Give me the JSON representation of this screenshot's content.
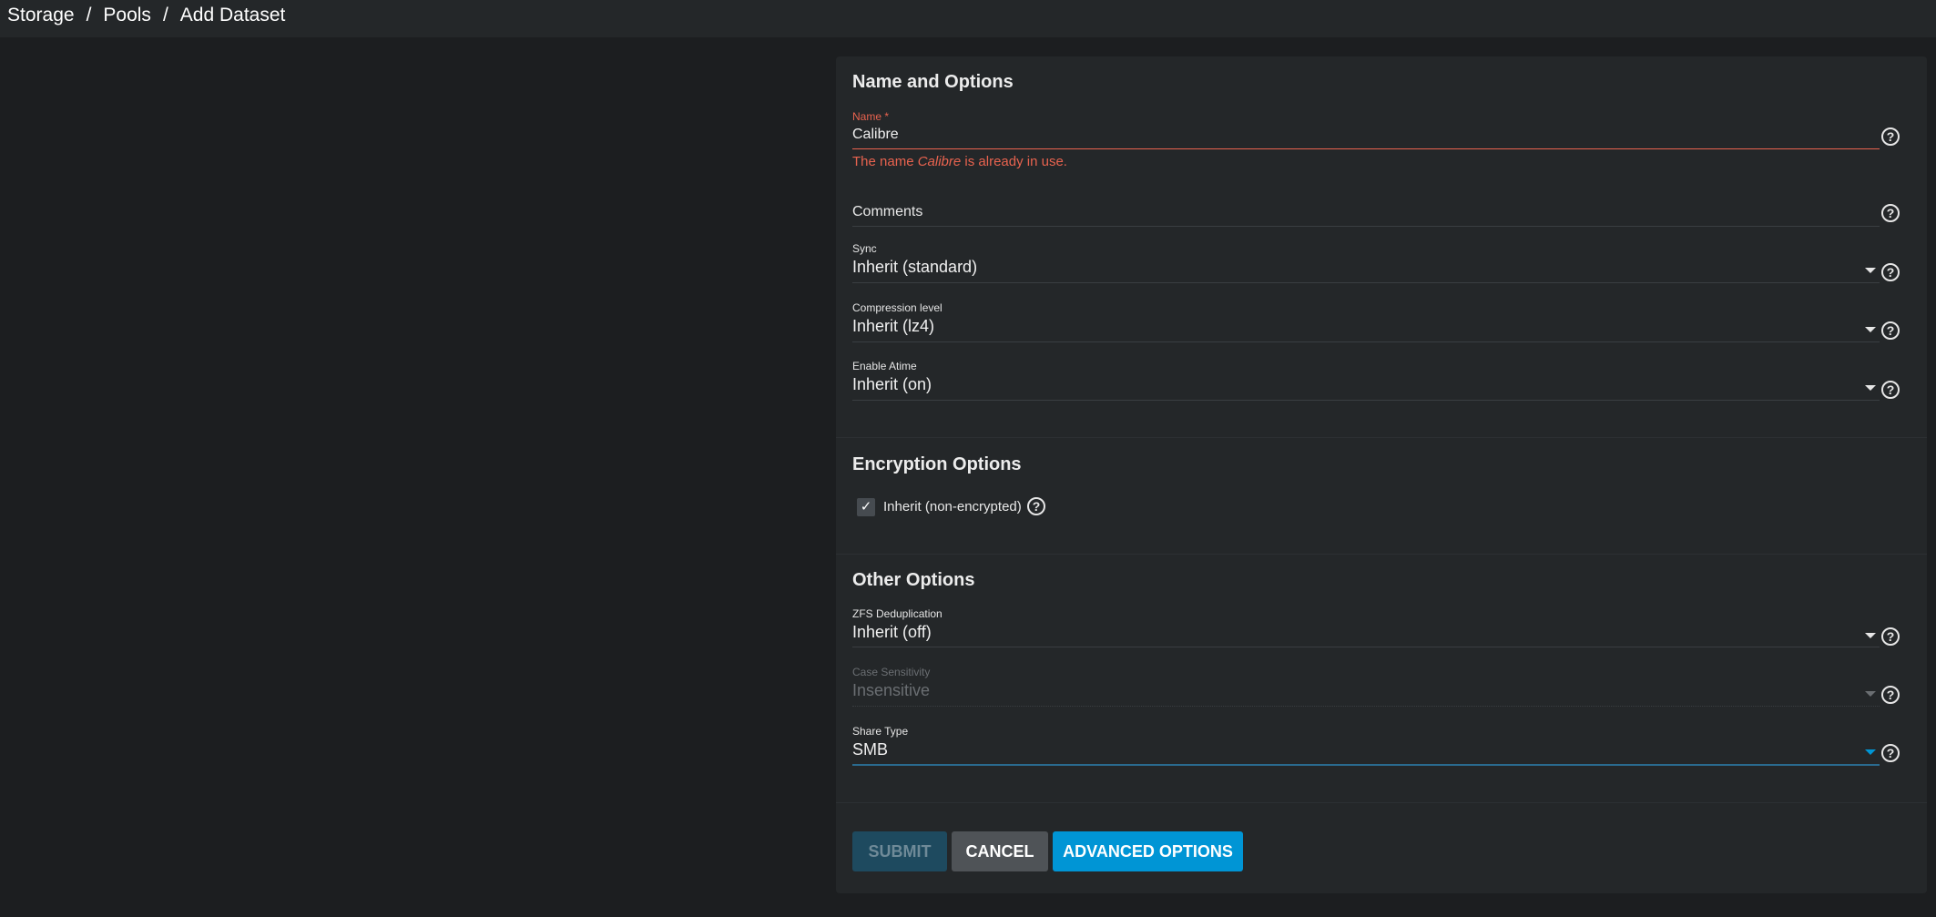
{
  "breadcrumb": [
    "Storage",
    "Pools",
    "Add Dataset"
  ],
  "sections": {
    "name_options": "Name and Options",
    "encryption": "Encryption Options",
    "other": "Other Options"
  },
  "name_field": {
    "label": "Name *",
    "value": "Calibre",
    "error_prefix": "The name ",
    "error_name": "Calibre",
    "error_suffix": " is already in use."
  },
  "comments_field": {
    "placeholder": "Comments"
  },
  "sync_field": {
    "label": "Sync",
    "value": "Inherit (standard)"
  },
  "compression_field": {
    "label": "Compression level",
    "value": "Inherit (lz4)"
  },
  "atime_field": {
    "label": "Enable Atime",
    "value": "Inherit (on)"
  },
  "encryption_checkbox": {
    "label": "Inherit (non-encrypted)",
    "checked": true
  },
  "dedup_field": {
    "label": "ZFS Deduplication",
    "value": "Inherit (off)"
  },
  "case_field": {
    "label": "Case Sensitivity",
    "value": "Insensitive",
    "disabled": true
  },
  "share_field": {
    "label": "Share Type",
    "value": "SMB"
  },
  "buttons": {
    "submit": "SUBMIT",
    "cancel": "CANCEL",
    "advanced": "ADVANCED OPTIONS"
  },
  "icons": {
    "help": "help-circle-icon",
    "check": "check-icon",
    "dropdown": "caret-down-icon"
  },
  "colors": {
    "page_bg": "#1c1e20",
    "card_bg": "#242729",
    "error": "#e8634f",
    "accent": "#0095d5",
    "submit_disabled": "#1e4a5f",
    "cancel_bg": "#4f5357"
  }
}
